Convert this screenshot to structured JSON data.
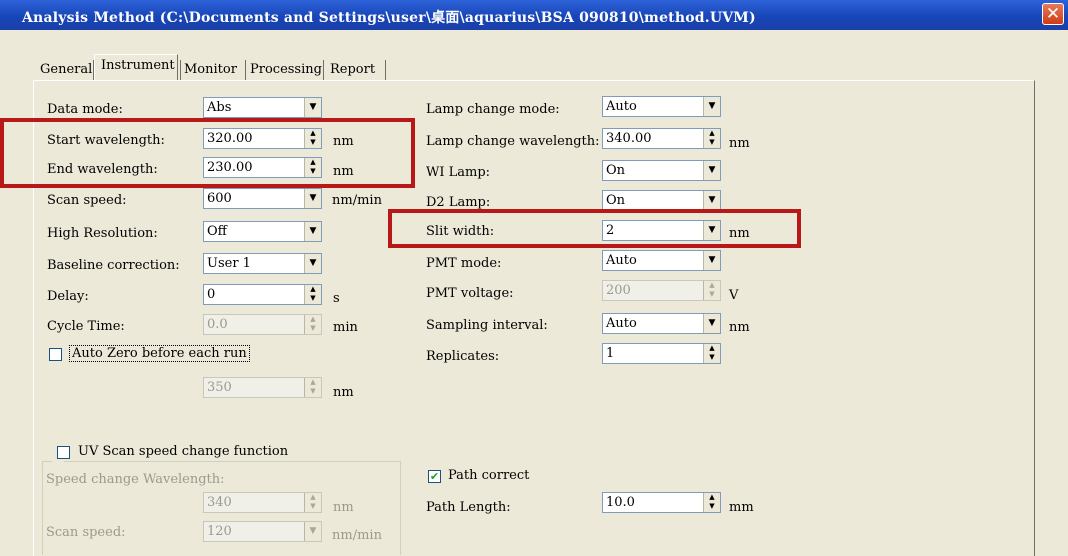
{
  "window": {
    "title": "Analysis Method (C:\\Documents and Settings\\user\\桌面\\aquarius\\BSA 090810\\method.UVM)",
    "close_glyph": "✕"
  },
  "tabs": [
    "General",
    "Instrument",
    "Monitor",
    "Processing",
    "Report"
  ],
  "selected_tab": "Instrument",
  "left": {
    "data_mode": {
      "label": "Data mode:",
      "value": "Abs"
    },
    "start_wavelength": {
      "label": "Start wavelength:",
      "value": "320.00",
      "unit": "nm"
    },
    "end_wavelength": {
      "label": "End wavelength:",
      "value": "230.00",
      "unit": "nm"
    },
    "scan_speed": {
      "label": "Scan speed:",
      "value": "600",
      "unit": "nm/min"
    },
    "high_resolution": {
      "label": "High Resolution:",
      "value": "Off"
    },
    "baseline_correction": {
      "label": "Baseline correction:",
      "value": "User 1"
    },
    "delay": {
      "label": "Delay:",
      "value": "0",
      "unit": "s"
    },
    "cycle_time": {
      "label": "Cycle Time:",
      "value": "0.0",
      "unit": "min"
    },
    "auto_zero": {
      "label": "Auto Zero before each run",
      "checked": false
    },
    "auto_zero_wavelength": {
      "value": "350",
      "unit": "nm"
    },
    "uv_scan_group": {
      "label": "UV Scan speed change function",
      "checked": false,
      "speed_change_wavelength": {
        "label": "Speed change Wavelength:",
        "value": "340",
        "unit": "nm"
      },
      "scan_speed": {
        "label": "Scan speed:",
        "value": "120",
        "unit": "nm/min"
      }
    }
  },
  "right": {
    "lamp_change_mode": {
      "label": "Lamp change mode:",
      "value": "Auto"
    },
    "lamp_change_wavelength": {
      "label": "Lamp change wavelength:",
      "value": "340.00",
      "unit": "nm"
    },
    "wi_lamp": {
      "label": "WI Lamp:",
      "value": "On"
    },
    "d2_lamp": {
      "label": "D2 Lamp:",
      "value": "On"
    },
    "slit_width": {
      "label": "Slit width:",
      "value": "2",
      "unit": "nm"
    },
    "pmt_mode": {
      "label": "PMT mode:",
      "value": "Auto"
    },
    "pmt_voltage": {
      "label": "PMT voltage:",
      "value": "200",
      "unit": "V"
    },
    "sampling_interval": {
      "label": "Sampling interval:",
      "value": "Auto",
      "unit": "nm"
    },
    "replicates": {
      "label": "Replicates:",
      "value": "1"
    },
    "path_correct": {
      "label": "Path correct",
      "checked": true
    },
    "path_length": {
      "label": "Path Length:",
      "value": "10.0",
      "unit": "mm"
    }
  },
  "icons": {
    "dropdown_arrow": "▼",
    "spin_up": "▲",
    "spin_down": "▼",
    "check": "✔"
  }
}
